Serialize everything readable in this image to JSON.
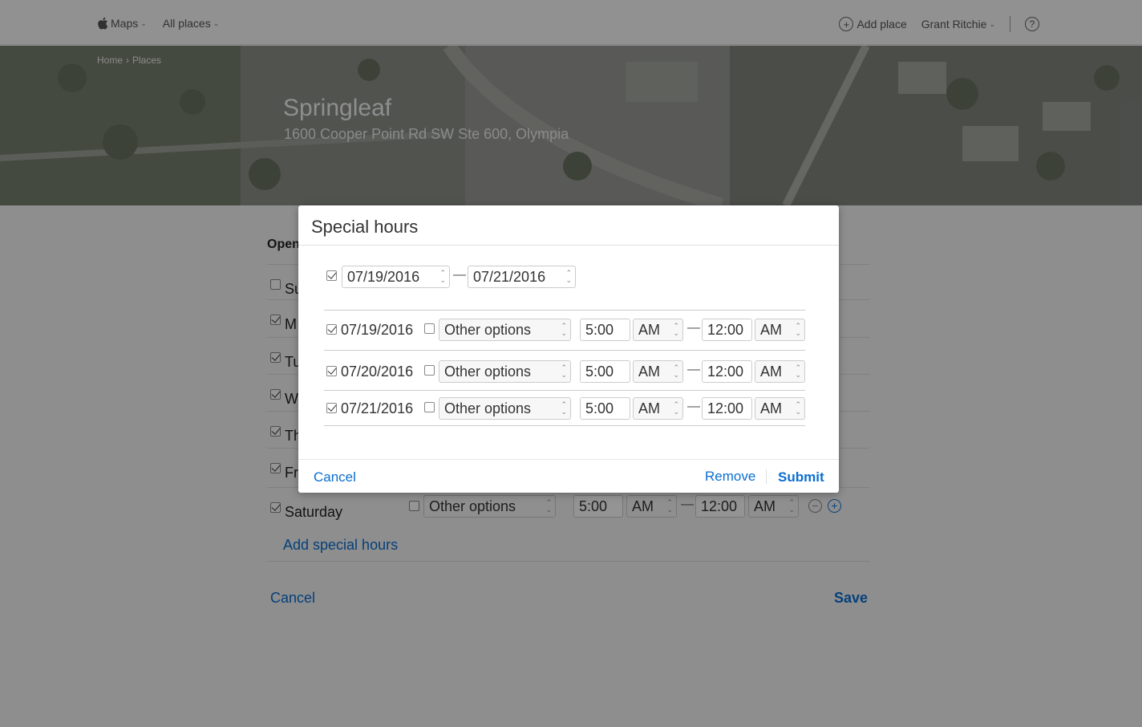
{
  "nav": {
    "brand": "Maps",
    "all_places": "All places",
    "add_place": "Add place",
    "user_name": "Grant Ritchie",
    "help_symbol": "?",
    "plus_symbol": "+",
    "chevron": "⌄"
  },
  "breadcrumb": {
    "home": "Home",
    "separator": "›",
    "places": "Places"
  },
  "place": {
    "name": "Springleaf",
    "address": "1600 Cooper Point Rd SW Ste 600, Olympia"
  },
  "background_form": {
    "open_label": "Open",
    "days": [
      {
        "label": "Su",
        "checked": false
      },
      {
        "label": "M",
        "checked": true
      },
      {
        "label": "Tu",
        "checked": true
      },
      {
        "label": "W",
        "checked": true
      },
      {
        "label": "Th",
        "checked": true
      },
      {
        "label": "Fr",
        "checked": true
      },
      {
        "label": "Saturday",
        "checked": true
      }
    ],
    "saturday": {
      "option": "Other options",
      "open_time": "5:00",
      "open_ampm": "AM",
      "close_time": "12:00",
      "close_ampm": "AM"
    },
    "dash": "—",
    "add_special_hours": "Add special hours",
    "cancel": "Cancel",
    "save": "Save"
  },
  "modal": {
    "title": "Special hours",
    "range_start": "07/19/2016",
    "range_end": "07/21/2016",
    "dash": "—",
    "rows": [
      {
        "date": "07/19/2016",
        "option": "Other options",
        "open_time": "5:00",
        "open_ampm": "AM",
        "close_time": "12:00",
        "close_ampm": "AM"
      },
      {
        "date": "07/20/2016",
        "option": "Other options",
        "open_time": "5:00",
        "open_ampm": "AM",
        "close_time": "12:00",
        "close_ampm": "AM"
      },
      {
        "date": "07/21/2016",
        "option": "Other options",
        "open_time": "5:00",
        "open_ampm": "AM",
        "close_time": "12:00",
        "close_ampm": "AM"
      }
    ],
    "cancel": "Cancel",
    "remove": "Remove",
    "submit": "Submit"
  },
  "colors": {
    "link": "#0a6ed1",
    "overlay": "rgba(0,0,0,0.42)"
  },
  "spinner_glyphs": {
    "up": "⌃",
    "down": "⌄"
  }
}
